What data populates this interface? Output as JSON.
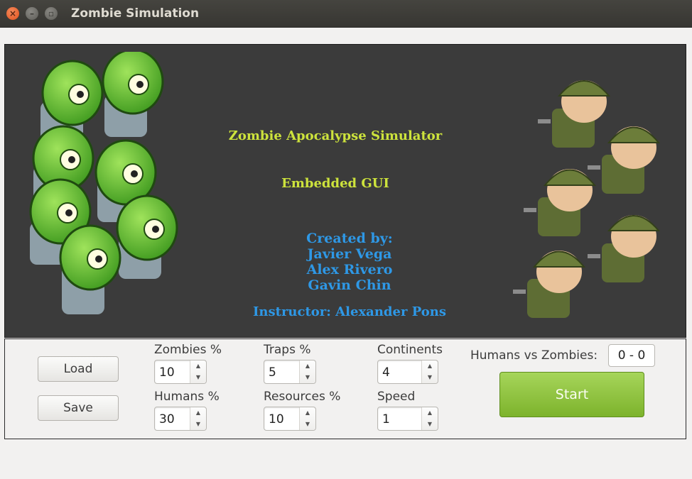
{
  "window": {
    "title": "Zombie Simulation"
  },
  "banner": {
    "title": "Zombie Apocalypse Simulator",
    "subtitle": "Embedded GUI",
    "created_by": "Created by:",
    "authors": [
      "Javier Vega",
      "Alex Rivero",
      "Gavin Chin"
    ],
    "instructor": "Instructor: Alexander Pons"
  },
  "controls": {
    "load_label": "Load",
    "save_label": "Save",
    "zombies": {
      "label": "Zombies %",
      "value": "10"
    },
    "humans": {
      "label": "Humans %",
      "value": "30"
    },
    "traps": {
      "label": "Traps %",
      "value": "5"
    },
    "resources": {
      "label": "Resources %",
      "value": "10"
    },
    "continents": {
      "label": "Continents",
      "value": "4"
    },
    "speed": {
      "label": "Speed",
      "value": "1"
    },
    "score_label": "Humans vs Zombies:",
    "score_value": "0 - 0",
    "start_label": "Start"
  },
  "colors": {
    "banner_bg": "#3b3b3b",
    "title_text": "#cde33c",
    "credit_text": "#2e98e6",
    "start_button": "#8cc43c",
    "close_button": "#e2511d"
  },
  "icons": {
    "close": "close-icon",
    "minimize": "minimize-icon",
    "maximize": "maximize-icon",
    "spin_up": "chevron-up-icon",
    "spin_down": "chevron-down-icon"
  }
}
